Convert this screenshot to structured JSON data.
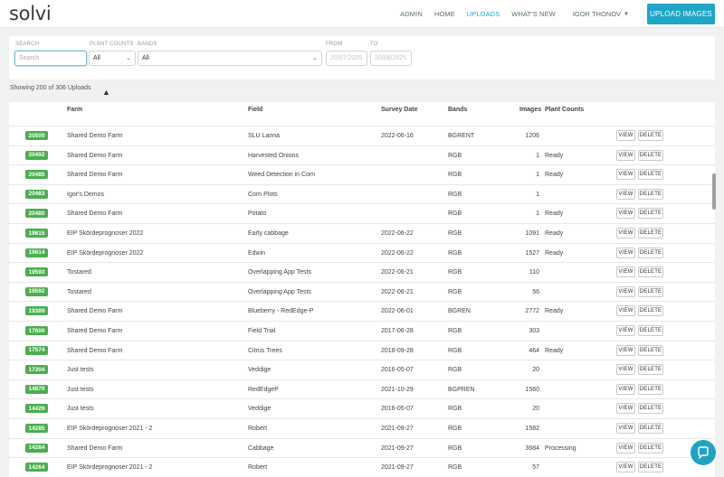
{
  "app": {
    "logo_text": "solvi",
    "accent_color": "#1fa6c6",
    "badge_color": "#4cae4f"
  },
  "nav": {
    "links": [
      "ADMIN",
      "HOME",
      "UPLOADS",
      "WHAT'S NEW"
    ],
    "active": "UPLOADS",
    "user": "IGOR THONOV",
    "upload_button": "UPLOAD IMAGES"
  },
  "filters": {
    "search_label": "SEARCH",
    "search_placeholder": "Search",
    "plant_counts_label": "PLANT COUNTS",
    "plant_counts_value": "All",
    "bands_label": "BANDS",
    "bands_value": "All",
    "from_label": "FROM",
    "from_value": "20/07/2025",
    "to_label": "TO",
    "to_value": "20/08/2025"
  },
  "status": {
    "showing_text": "Showing 200 of 306 Uploads"
  },
  "table": {
    "headers": [
      "Farm",
      "Field",
      "Survey Date",
      "Bands",
      "Images",
      "Plant Counts"
    ],
    "view_label": "VIEW",
    "delete_label": "DELETE",
    "rows": [
      {
        "id": "20500",
        "farm": "Shared Demo Farm",
        "field": "SLU Lanna",
        "date": "2022-06-16",
        "bands": "BGRENT",
        "images": "1206",
        "plant_counts": ""
      },
      {
        "id": "20492",
        "farm": "Shared Demo Farm",
        "field": "Harvested Onions",
        "date": "",
        "bands": "RGB",
        "images": "1",
        "plant_counts": "Ready"
      },
      {
        "id": "20485",
        "farm": "Shared Demo Farm",
        "field": "Weed Detection in Corn",
        "date": "",
        "bands": "RGB",
        "images": "1",
        "plant_counts": "Ready"
      },
      {
        "id": "20483",
        "farm": "Igor's Demos",
        "field": "Corn Plots",
        "date": "",
        "bands": "RGB",
        "images": "1",
        "plant_counts": ""
      },
      {
        "id": "20480",
        "farm": "Shared Demo Farm",
        "field": "Potato",
        "date": "",
        "bands": "RGB",
        "images": "1",
        "plant_counts": "Ready"
      },
      {
        "id": "19615",
        "farm": "EIP Skördeprognoser 2022",
        "field": "Early cabbage",
        "date": "2022-06-22",
        "bands": "RGB",
        "images": "1091",
        "plant_counts": "Ready"
      },
      {
        "id": "19614",
        "farm": "EIP Skördeprognoser 2022",
        "field": "Edwin",
        "date": "2022-06-22",
        "bands": "RGB",
        "images": "1527",
        "plant_counts": "Ready"
      },
      {
        "id": "19593",
        "farm": "Tostared",
        "field": "Overlapping App Tests",
        "date": "2022-06-21",
        "bands": "RGB",
        "images": "110",
        "plant_counts": ""
      },
      {
        "id": "19592",
        "farm": "Tostared",
        "field": "Overlapping App Tests",
        "date": "2022-06-21",
        "bands": "RGB",
        "images": "56",
        "plant_counts": ""
      },
      {
        "id": "19389",
        "farm": "Shared Demo Farm",
        "field": "Blueberry - RedEdge-P",
        "date": "2022-06-01",
        "bands": "BGREN",
        "images": "2772",
        "plant_counts": "Ready"
      },
      {
        "id": "17600",
        "farm": "Shared Demo Farm",
        "field": "Field Trial",
        "date": "2017-06-28",
        "bands": "RGB",
        "images": "303",
        "plant_counts": ""
      },
      {
        "id": "17574",
        "farm": "Shared Demo Farm",
        "field": "Citrus Trees",
        "date": "2018-09-28",
        "bands": "RGB",
        "images": "464",
        "plant_counts": "Ready"
      },
      {
        "id": "17304",
        "farm": "Just tests",
        "field": "Veddige",
        "date": "2016-05-07",
        "bands": "RGB",
        "images": "20",
        "plant_counts": ""
      },
      {
        "id": "14870",
        "farm": "Just tests",
        "field": "RedEdgeP",
        "date": "2021-10-29",
        "bands": "BGPREN",
        "images": "1560",
        "plant_counts": ""
      },
      {
        "id": "14429",
        "farm": "Just tests",
        "field": "Veddige",
        "date": "2016-05-07",
        "bands": "RGB",
        "images": "20",
        "plant_counts": ""
      },
      {
        "id": "14285",
        "farm": "EIP Skördeprognoser 2021 - 2",
        "field": "Robert",
        "date": "2021-09-27",
        "bands": "RGB",
        "images": "1582",
        "plant_counts": ""
      },
      {
        "id": "14284",
        "farm": "Shared Demo Farm",
        "field": "Cabbage",
        "date": "2021-09-27",
        "bands": "RGB",
        "images": "3684",
        "plant_counts": "Processing"
      },
      {
        "id": "14264",
        "farm": "EIP Skördeprognoser 2021 - 2",
        "field": "Robert",
        "date": "2021-09-27",
        "bands": "RGB",
        "images": "57",
        "plant_counts": ""
      }
    ]
  }
}
